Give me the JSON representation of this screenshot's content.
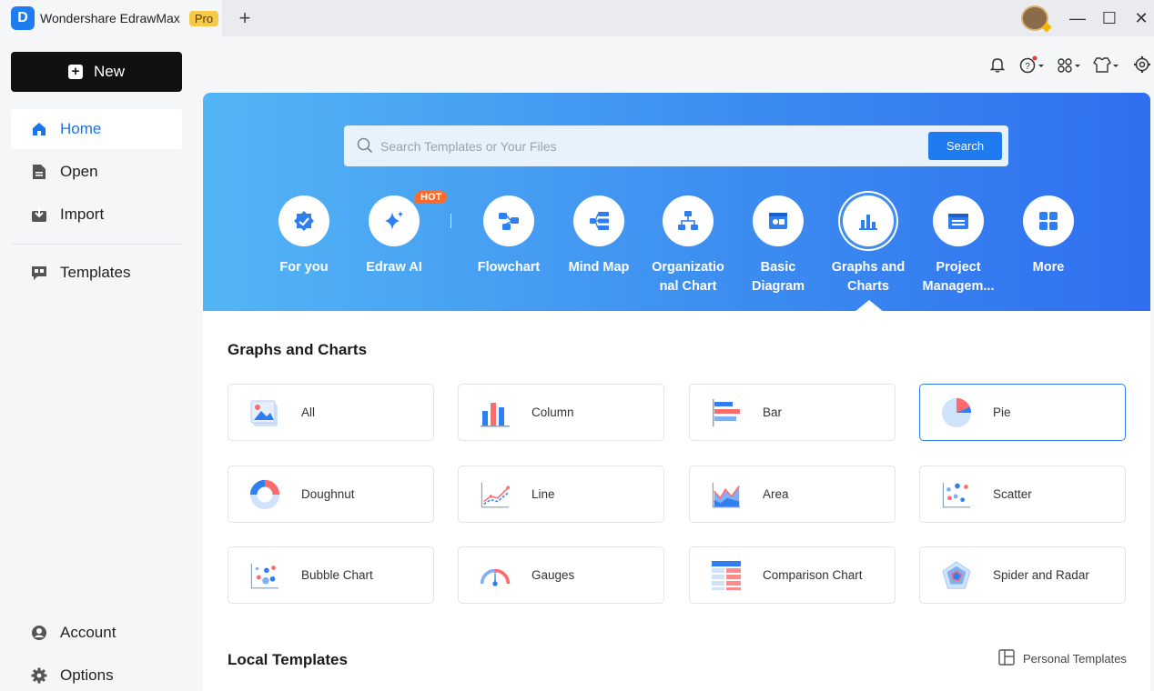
{
  "titlebar": {
    "app_logo": "D",
    "app_name": "Wondershare EdrawMax",
    "pro_badge": "Pro",
    "new_tab": "+",
    "window_controls": {
      "minimize": "—",
      "maximize": "☐",
      "close": "✕"
    }
  },
  "sidebar": {
    "new_label": "New",
    "items": [
      {
        "label": "Home",
        "icon": "home-icon",
        "active": true
      },
      {
        "label": "Open",
        "icon": "file-icon",
        "active": false
      },
      {
        "label": "Import",
        "icon": "import-icon",
        "active": false
      },
      {
        "label": "Templates",
        "icon": "templates-icon",
        "active": false
      }
    ],
    "bottom_items": [
      {
        "label": "Account",
        "icon": "account-icon"
      },
      {
        "label": "Options",
        "icon": "gear-icon"
      }
    ]
  },
  "toolbar_icons": [
    "bell-icon",
    "help-icon",
    "apps-icon",
    "shirt-icon",
    "settings-icon"
  ],
  "search": {
    "placeholder": "Search Templates or Your Files",
    "button_label": "Search"
  },
  "categories": [
    {
      "label": "For you",
      "icon": "for-you-icon"
    },
    {
      "label": "Edraw AI",
      "icon": "sparkle-icon",
      "badge": "HOT"
    },
    {
      "label": "Flowchart",
      "icon": "flowchart-icon"
    },
    {
      "label": "Mind Map",
      "icon": "mindmap-icon"
    },
    {
      "label": "Organizational Chart",
      "display_line1": "Organizatio",
      "display_line2": "nal Chart",
      "icon": "org-chart-icon"
    },
    {
      "label": "Basic Diagram",
      "display_line1": "Basic",
      "display_line2": "Diagram",
      "icon": "basic-diagram-icon"
    },
    {
      "label": "Graphs and Charts",
      "display_line1": "Graphs and",
      "display_line2": "Charts",
      "icon": "bar-chart-icon",
      "selected": true
    },
    {
      "label": "Project Management",
      "display_line1": "Project",
      "display_line2": "Managem...",
      "icon": "project-icon"
    },
    {
      "label": "More",
      "icon": "more-grid-icon"
    }
  ],
  "section": {
    "title": "Graphs and Charts",
    "items": [
      {
        "label": "All",
        "icon": "all-charts-icon"
      },
      {
        "label": "Column",
        "icon": "column-chart-icon"
      },
      {
        "label": "Bar",
        "icon": "bar-chart-icon"
      },
      {
        "label": "Pie",
        "icon": "pie-chart-icon",
        "selected": true
      },
      {
        "label": "Doughnut",
        "icon": "doughnut-chart-icon"
      },
      {
        "label": "Line",
        "icon": "line-chart-icon"
      },
      {
        "label": "Area",
        "icon": "area-chart-icon"
      },
      {
        "label": "Scatter",
        "icon": "scatter-chart-icon"
      },
      {
        "label": "Bubble Chart",
        "icon": "bubble-chart-icon"
      },
      {
        "label": "Gauges",
        "icon": "gauge-icon"
      },
      {
        "label": "Comparison Chart",
        "icon": "comparison-chart-icon"
      },
      {
        "label": "Spider and Radar",
        "icon": "radar-chart-icon"
      }
    ]
  },
  "local_templates": {
    "title": "Local Templates",
    "personal_link": "Personal Templates"
  },
  "colors": {
    "accent": "#1f7cf0",
    "pro_badge": "#f7c948",
    "hot_badge": "#ff6a2b",
    "banner_start": "#53b5f5",
    "banner_end": "#2f6ff0"
  }
}
